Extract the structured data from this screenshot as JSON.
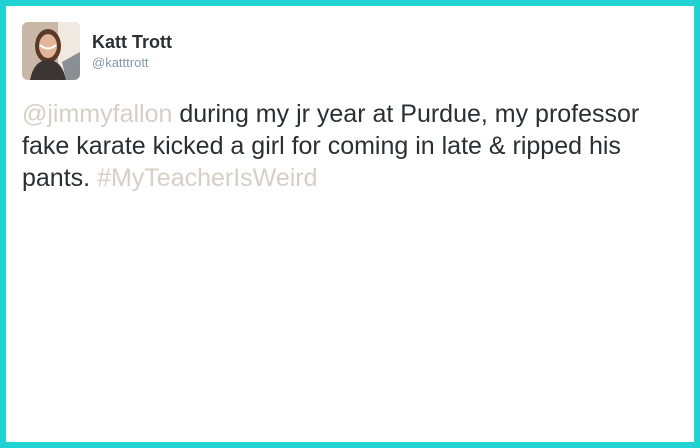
{
  "tweet": {
    "author": {
      "display_name": "Katt Trott",
      "handle": "@katttrott",
      "avatar_icon": "profile-photo"
    },
    "text": {
      "mention": "@jimmyfallon",
      "body": " during my jr year at Purdue, my professor fake karate kicked a girl for coming in late & ripped his pants. ",
      "hashtag": "#MyTeacherIsWeird"
    }
  },
  "colors": {
    "border": "#1fd3d3",
    "text": "#292f33",
    "handle": "#8899a6",
    "link": "#d6cfc6"
  }
}
